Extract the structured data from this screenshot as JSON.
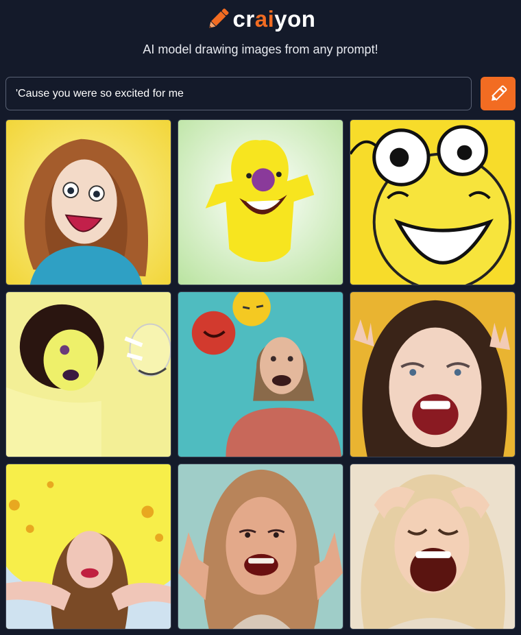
{
  "header": {
    "brand_prefix": "cr",
    "brand_accent": "ai",
    "brand_suffix": "yon",
    "tagline": "AI model drawing images from any prompt!",
    "logo_icon": "pencil-icon"
  },
  "prompt": {
    "value": "'Cause you were so excited for me",
    "button_icon": "pencil-icon"
  },
  "colors": {
    "accent": "#f26c22",
    "background": "#141a2a",
    "input_border": "#5a6275"
  },
  "images": [
    {
      "name": "generated-image-1",
      "subject": "cartoon woman with brown hair laughing"
    },
    {
      "name": "generated-image-2",
      "subject": "yellow cartoon blob smiling"
    },
    {
      "name": "generated-image-3",
      "subject": "yellow smiley faces laughing"
    },
    {
      "name": "generated-image-4",
      "subject": "yellow cartoon faces"
    },
    {
      "name": "generated-image-5",
      "subject": "girl laughing with emoji balloons"
    },
    {
      "name": "generated-image-6",
      "subject": "woman screaming with excitement"
    },
    {
      "name": "generated-image-7",
      "subject": "girl with yellow balloon background"
    },
    {
      "name": "generated-image-8",
      "subject": "blonde girl laughing with hands up"
    },
    {
      "name": "generated-image-9",
      "subject": "blonde woman laughing holding head"
    }
  ]
}
